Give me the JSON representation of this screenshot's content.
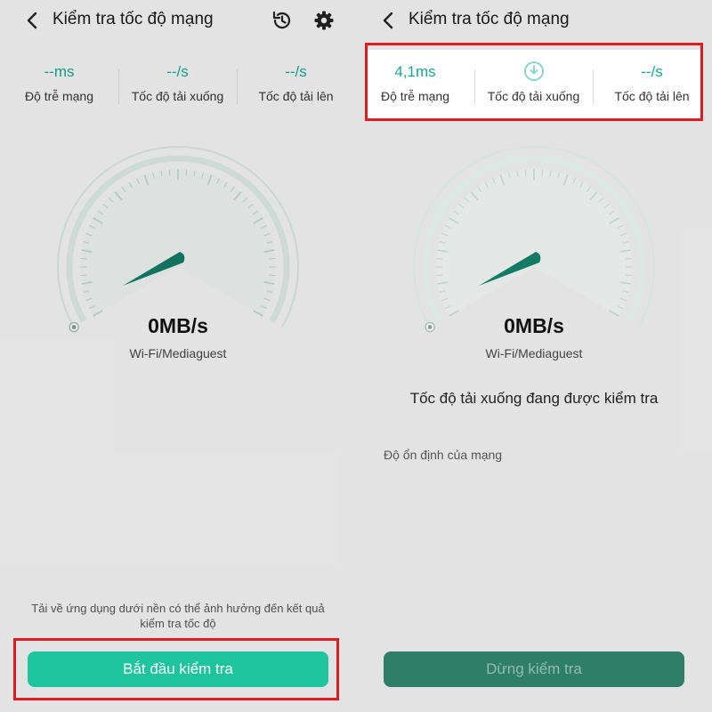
{
  "left": {
    "title": "Kiểm tra tốc độ mạng",
    "metrics": [
      {
        "value": "--ms",
        "label": "Độ trễ mạng"
      },
      {
        "value": "--/s",
        "label": "Tốc độ tải xuống"
      },
      {
        "value": "--/s",
        "label": "Tốc độ tải lên"
      }
    ],
    "speed": "0MB/s",
    "network": "Wi-Fi/Mediaguest",
    "footer_note": "Tải về ứng dụng dưới nền có thể ảnh hưởng đến kết quả kiểm tra tốc độ",
    "start_button": "Bắt đầu kiểm tra"
  },
  "right": {
    "title": "Kiểm tra tốc độ mạng",
    "metrics": [
      {
        "value": "4,1ms",
        "label": "Độ trễ mạng"
      },
      {
        "icon": "download-progress-icon",
        "label": "Tốc độ tải xuống"
      },
      {
        "value": "--/s",
        "label": "Tốc độ tải lên"
      }
    ],
    "speed": "0MB/s",
    "network": "Wi-Fi/Mediaguest",
    "status_text": "Tốc độ tải xuống đang được kiểm tra",
    "stability_label": "Độ ổn định của mạng",
    "stop_button": "Dừng kiểm tra"
  },
  "icons": {
    "back": "back-arrow-icon",
    "history": "history-icon",
    "settings": "gear-icon",
    "gauge": "speedometer-icon"
  },
  "colors": {
    "accent": "#1dc49e",
    "accent_text": "#16a98f",
    "stop_button": "#2f7e68",
    "highlight": "#e01b22",
    "gauge_needle": "#137a66"
  }
}
